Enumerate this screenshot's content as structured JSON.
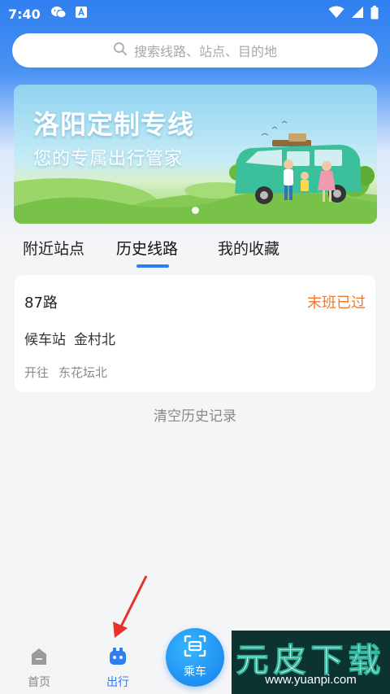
{
  "status_bar": {
    "time": "7:40"
  },
  "search": {
    "placeholder": "搜索线路、站点、目的地"
  },
  "banner": {
    "title": "洛阳定制专线",
    "subtitle": "您的专属出行管家"
  },
  "tabs": [
    {
      "label": "附近站点",
      "active": false
    },
    {
      "label": "历史线路",
      "active": true
    },
    {
      "label": "我的收藏",
      "active": false
    }
  ],
  "route_card": {
    "route_name": "87路",
    "status": "末班已过",
    "waiting_label": "候车站",
    "waiting_station": "金村北",
    "direction_label": "开往",
    "direction_station": "东花坛北"
  },
  "clear_history_label": "清空历史记录",
  "bottom_nav": {
    "home_label": "首页",
    "trip_label": "出行",
    "ride_label": "乘车"
  },
  "watermark": {
    "title": "元皮下载",
    "url": "www.yuanpi.com"
  },
  "colors": {
    "primary": "#2d7ef0",
    "status_orange": "#f0782d",
    "background": "#f4f5f7"
  },
  "icons": [
    "wechat-icon",
    "app-notification-icon",
    "wifi-icon",
    "signal-icon",
    "battery-icon",
    "search-icon",
    "home-icon",
    "trip-icon",
    "scan-icon",
    "arrow-icon"
  ]
}
